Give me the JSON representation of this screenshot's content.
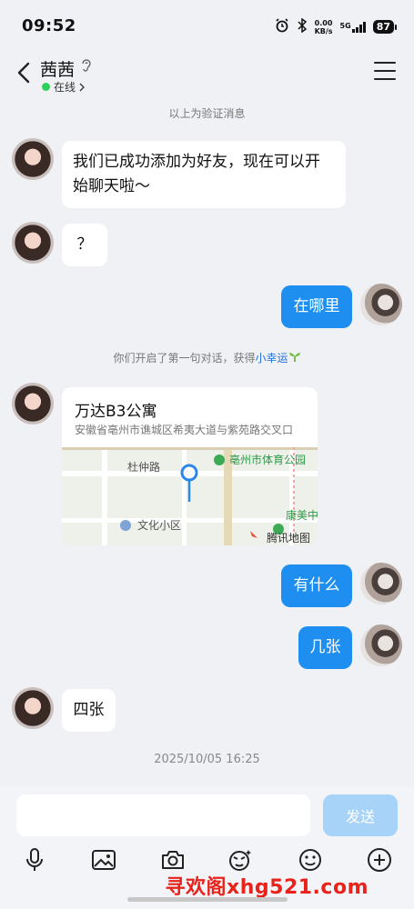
{
  "status_bar": {
    "time": "09:52",
    "net_speed_value": "0.00",
    "net_speed_unit": "KB/s",
    "network_type": "5G",
    "battery": "87"
  },
  "header": {
    "contact_name": "茜茜",
    "online_label": "在线"
  },
  "chat": {
    "verification_note": "以上为验证消息",
    "messages": [
      {
        "from": "them",
        "text": "我们已成功添加为好友，现在可以开始聊天啦～"
      },
      {
        "from": "them",
        "text": "？"
      },
      {
        "from": "me",
        "text": "在哪里"
      },
      {
        "from": "me",
        "text": "有什么"
      },
      {
        "from": "me",
        "text": "几张"
      },
      {
        "from": "them",
        "text": "四张"
      }
    ],
    "first_chat_note": "你们开启了第一句对话，获得",
    "first_chat_reward": "小幸运",
    "location": {
      "title": "万达B3公寓",
      "address": "安徽省亳州市谯城区希夷大道与紫苑路交叉口",
      "map_labels": [
        "杜仲路",
        "亳州市体育公园",
        "文化小区",
        "康美中",
        "腾讯地图"
      ]
    },
    "timestamp": "2025/10/05 16:25"
  },
  "input": {
    "placeholder": "",
    "send_label": "发送"
  },
  "watermark": "寻欢阁xhg521.com",
  "colors": {
    "accent": "#1e8ff0",
    "send_disabled": "#a7d3f8",
    "online": "#2fd05a",
    "background": "#f0f1f5"
  },
  "toolbar_icons": [
    "microphone-icon",
    "image-icon",
    "camera-icon",
    "sticker-icon",
    "emoji-icon",
    "plus-icon"
  ]
}
